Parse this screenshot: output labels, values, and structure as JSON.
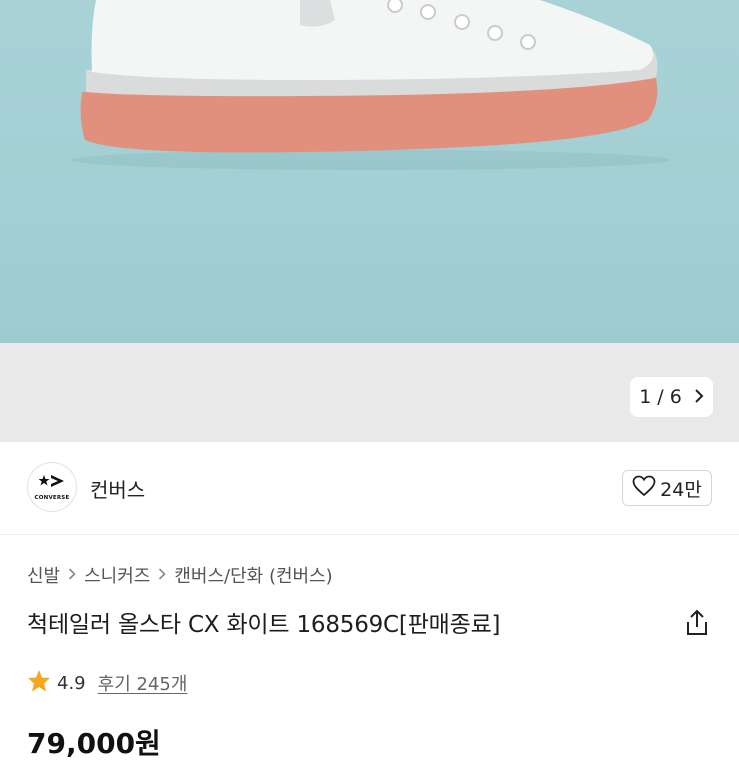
{
  "gallery": {
    "counter_current": "1",
    "counter_separator": "/",
    "counter_total": "6",
    "colors": {
      "background": "#a3cfd4",
      "sole": "#e2907e"
    }
  },
  "brand": {
    "name": "컨버스",
    "logo_icon": "converse-star-chevron-icon",
    "logo_wordmark": "CONVERSE"
  },
  "like": {
    "icon": "heart-outline-icon",
    "count": "24만"
  },
  "breadcrumb": {
    "items": [
      "신발",
      "스니커즈",
      "캔버스/단화 (컨버스)"
    ],
    "separator_icon": "chevron-right-icon"
  },
  "product": {
    "title": "척테일러 올스타 CX 화이트 168569C[판매종료]",
    "share_icon": "share-icon"
  },
  "rating": {
    "star_icon": "star-icon",
    "score": "4.9",
    "reviews_label": "후기 245개",
    "star_color": "#f4a81d"
  },
  "price": {
    "value": "79,000원"
  }
}
